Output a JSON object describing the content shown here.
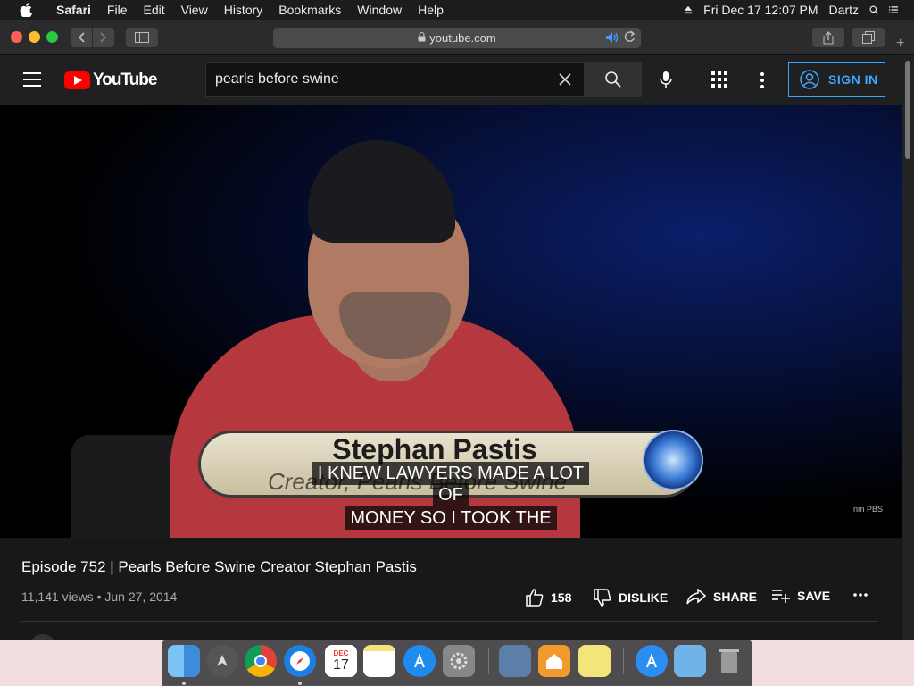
{
  "menubar": {
    "app_name": "Safari",
    "items": [
      "File",
      "Edit",
      "View",
      "History",
      "Bookmarks",
      "Window",
      "Help"
    ],
    "datetime": "Fri Dec 17  12:07 PM",
    "user": "Dartz"
  },
  "browser": {
    "url": "youtube.com"
  },
  "youtube": {
    "logo_text": "YouTube",
    "search_value": "pearls before swine",
    "signin_label": "SIGN IN",
    "video": {
      "lower_third_name": "Stephan Pastis",
      "lower_third_subtitle": "Creator, Pearls Before Swine",
      "caption_lines": [
        "I KNEW LAWYERS MADE A LOT",
        "OF",
        "MONEY SO I TOOK THE"
      ],
      "watermark": "nm PBS"
    },
    "title": "Episode 752 | Pearls Before Swine Creator Stephan Pastis",
    "views": "11,141 views",
    "date": "Jun 27, 2014",
    "likes": "158",
    "dislike_label": "DISLIKE",
    "share_label": "SHARE",
    "save_label": "SAVE"
  },
  "dock": {
    "calendar_month": "DEC",
    "calendar_day": "17"
  },
  "colors": {
    "accent_blue": "#3ea6ff",
    "youtube_red": "#ff0000",
    "page_bg": "#181818"
  }
}
